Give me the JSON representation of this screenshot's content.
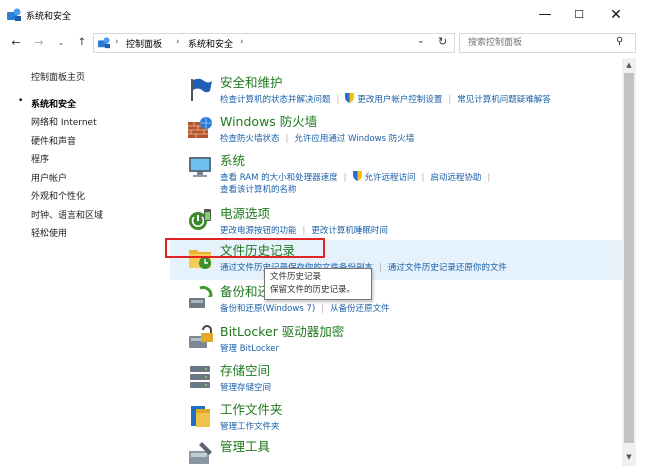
{
  "window": {
    "title": "系统和安全",
    "minimize": "—",
    "maximize": "☐",
    "close": "✕"
  },
  "nav": {
    "back": "←",
    "forward": "→",
    "recent": "⌄",
    "up": "↑",
    "breadcrumbs": [
      "控制面板",
      "系统和安全"
    ],
    "sep": "›",
    "dropdown": "⌄",
    "refresh": "↻"
  },
  "search": {
    "placeholder": "搜索控制面板",
    "icon": "⚲"
  },
  "sidebar": {
    "items": [
      {
        "label": "控制面板主页"
      },
      {
        "label": "系统和安全"
      },
      {
        "label": "网络和 Internet"
      },
      {
        "label": "硬件和声音"
      },
      {
        "label": "程序"
      },
      {
        "label": "用户帐户"
      },
      {
        "label": "外观和个性化"
      },
      {
        "label": "时钟、语言和区域"
      },
      {
        "label": "轻松使用"
      }
    ],
    "bullet": "•"
  },
  "categories": [
    {
      "title": "安全和维护",
      "icon": "flag-icon",
      "links": [
        "检查计算机的状态并解决问题",
        "更改用户帐户控制设置",
        "常见计算机问题疑难解答"
      ]
    },
    {
      "title": "Windows 防火墙",
      "icon": "firewall-icon",
      "links": [
        "检查防火墙状态",
        "允许应用通过 Windows 防火墙"
      ]
    },
    {
      "title": "系统",
      "icon": "computer-icon",
      "links": [
        "查看 RAM 的大小和处理器速度",
        "允许远程访问",
        "启动远程协助"
      ],
      "links2": [
        "查看该计算机的名称"
      ]
    },
    {
      "title": "电源选项",
      "icon": "power-icon",
      "links": [
        "更改电源按钮的功能",
        "更改计算机睡眠时间"
      ]
    },
    {
      "title": "文件历史记录",
      "icon": "file-history-icon",
      "links": [
        "通过文件历史记录保存你的文件备份副本",
        "通过文件历史记录还原你的文件"
      ]
    },
    {
      "title": "备份和还原(Windows 7)",
      "icon": "backup-icon",
      "links": [
        "备份和还原(Windows 7)",
        "从备份还原文件"
      ]
    },
    {
      "title": "BitLocker 驱动器加密",
      "icon": "bitlocker-icon",
      "links": [
        "管理 BitLocker"
      ]
    },
    {
      "title": "存储空间",
      "icon": "storage-icon",
      "links": [
        "管理存储空间"
      ]
    },
    {
      "title": "工作文件夹",
      "icon": "work-folders-icon",
      "links": [
        "管理工作文件夹"
      ]
    },
    {
      "title": "管理工具",
      "icon": "admin-tools-icon",
      "links": []
    }
  ],
  "tooltip": {
    "line1": "文件历史记录",
    "line2": "保留文件的历史记录。"
  },
  "scrollbar": {
    "up": "▲",
    "down": "▼"
  },
  "colors": {
    "link": "#1a5fa8",
    "category_title": "#1e7a1e",
    "hover_bg": "#e5f1fb",
    "highlight": "#e02323"
  }
}
